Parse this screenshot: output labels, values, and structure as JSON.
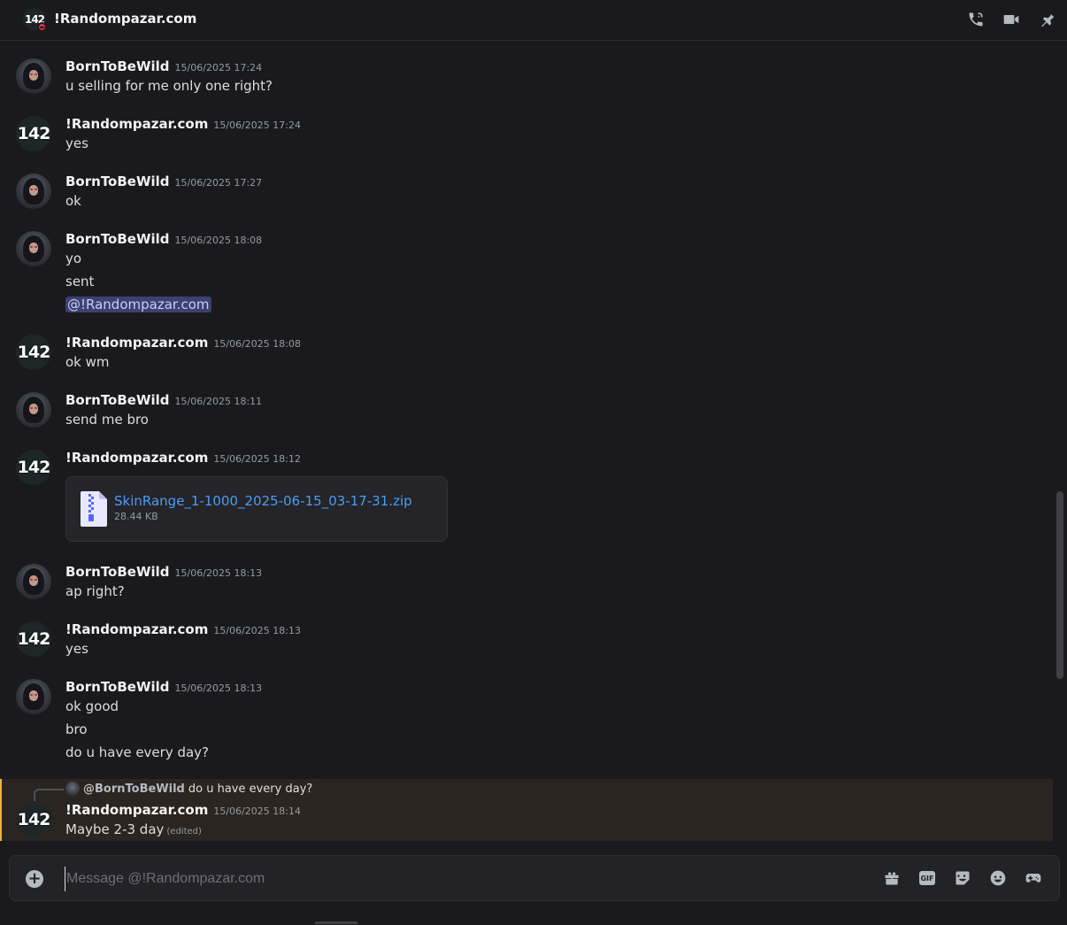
{
  "header": {
    "avatar_text": "142",
    "title": "!Randompazar.com",
    "icons": [
      "phone-call-icon",
      "video-camera-icon",
      "pin-icon"
    ]
  },
  "messages": [
    {
      "author": "BornToBeWild",
      "timestamp": "15/06/2025 17:24",
      "lines": [
        "u selling for me only one right?"
      ]
    },
    {
      "author": "!Randompazar.com",
      "timestamp": "15/06/2025 17:24",
      "lines": [
        "yes"
      ]
    },
    {
      "author": "BornToBeWild",
      "timestamp": "15/06/2025 17:27",
      "lines": [
        "ok"
      ]
    },
    {
      "author": "BornToBeWild",
      "timestamp": "15/06/2025 18:08",
      "lines": [
        "yo",
        "sent"
      ],
      "mention": "@!Randompazar.com"
    },
    {
      "author": "!Randompazar.com",
      "timestamp": "15/06/2025 18:08",
      "lines": [
        "ok wm"
      ]
    },
    {
      "author": "BornToBeWild",
      "timestamp": "15/06/2025 18:11",
      "lines": [
        "send me bro"
      ]
    },
    {
      "author": "!Randompazar.com",
      "timestamp": "15/06/2025 18:12",
      "attachment": {
        "name": "SkinRange_1-1000_2025-06-15_03-17-31.zip",
        "size": "28.44 KB"
      }
    },
    {
      "author": "BornToBeWild",
      "timestamp": "15/06/2025 18:13",
      "lines": [
        "ap right?"
      ]
    },
    {
      "author": "!Randompazar.com",
      "timestamp": "15/06/2025 18:13",
      "lines": [
        "yes"
      ]
    },
    {
      "author": "BornToBeWild",
      "timestamp": "15/06/2025 18:13",
      "lines": [
        "ok good",
        "bro",
        "do u have every day?"
      ]
    },
    {
      "author": "!Randompazar.com",
      "timestamp": "15/06/2025 18:14",
      "reply_to": {
        "user": "@BornToBeWild",
        "text": "do u have every day?"
      },
      "lines": [
        "Maybe 2-3 day"
      ],
      "edited": "(edited)"
    }
  ],
  "avatar_142_text": "142",
  "composer": {
    "placeholder": "Message @!Randompazar.com",
    "plus": "+",
    "gif_label": "GIF",
    "icons": [
      "gift-icon",
      "gif-icon",
      "sticker-icon",
      "emoji-icon",
      "gamepad-icon"
    ]
  }
}
